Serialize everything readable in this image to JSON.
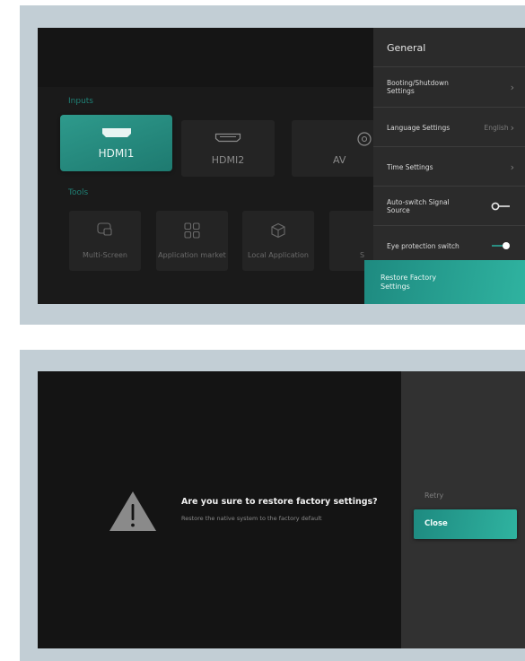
{
  "home": {
    "inputs_label": "Inputs",
    "inputs": [
      {
        "label": "HDMI1",
        "icon": "hdmi-icon",
        "active": true
      },
      {
        "label": "HDMI2",
        "icon": "hdmi-icon",
        "active": false
      },
      {
        "label": "AV",
        "icon": "av-icon",
        "active": false
      }
    ],
    "tools_label": "Tools",
    "tools": [
      {
        "label": "Multi-Screen",
        "icon": "multi-screen-icon"
      },
      {
        "label": "Application market",
        "icon": "app-grid-icon"
      },
      {
        "label": "Local Application",
        "icon": "cube-icon"
      },
      {
        "label": "S",
        "icon": "partial-tool-icon"
      }
    ]
  },
  "settings": {
    "title": "General",
    "items": [
      {
        "label": "Booting/Shutdown Settings",
        "value": "",
        "control": "chevron"
      },
      {
        "label": "Language Settings",
        "value": "English",
        "control": "chevron"
      },
      {
        "label": "Time Settings",
        "value": "",
        "control": "chevron"
      },
      {
        "label": "Auto-switch Signal Source",
        "value": "",
        "control": "toggle",
        "state": "off"
      },
      {
        "label": "Eye protection switch",
        "value": "",
        "control": "toggle",
        "state": "on"
      }
    ],
    "selected": "Restore Factory Settings"
  },
  "dialog": {
    "title": "Are you sure to restore factory settings?",
    "subtitle": "Restore the native system to the factory default",
    "retry_label": "Retry",
    "close_label": "Close",
    "icon": "warning-icon"
  },
  "colors": {
    "accent": "#2aa898",
    "background": "#141414",
    "panel": "#2b2b2b",
    "frame": "#c2ced5"
  }
}
